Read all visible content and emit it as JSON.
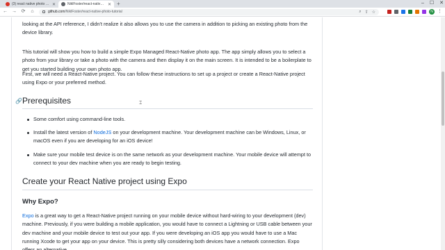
{
  "browser": {
    "tabs": [
      {
        "title": "(3) react native photo tutorial - ...",
        "active": false
      },
      {
        "title": "NiklFoster/react-native-photo-tu...",
        "active": true
      }
    ],
    "new_tab": "+",
    "window_controls": [
      "–",
      "☐",
      "✕"
    ],
    "nav": {
      "back": "←",
      "forward": "→",
      "reload": "⟳",
      "home": "⌂"
    },
    "url_host": "github.com",
    "url_path": "/NiklFoster/react-native-photo-tutorial",
    "omnibox_icons": [
      "search-icon",
      "share-icon",
      "star-icon"
    ],
    "extension_colors": [
      "#c5221f",
      "#5f6368",
      "#1a73e8",
      "#188038",
      "#e37400",
      "#9334e6"
    ],
    "avatar_letter": "N"
  },
  "article": {
    "p1": "looking at the API reference, I didn't realize it also allows you to use the camera in addition to picking an existing photo from the device library.",
    "p2": "This tutorial will show you how to build a simple Expo Managed React-Native photo app. The app simply allows you to select a photo from your library or take a photo with the camera and then display it on the main screen. It is intended to be a boilerplate to get you started building your own photo app.",
    "p3": "First, we will need a React-Native project. You can follow these instructions to set up a project or create a React-Native project using Expo or your preferred method.",
    "prereq_heading": "Prerequisites",
    "prereq_items": {
      "item1": "Some comfort using command-line tools.",
      "item2_before": "Install the latest version of ",
      "item2_link": "NodeJS",
      "item2_after": " on your development machine. Your development machine can be Windows, Linux, or macOS even if you are developing for an iOS device!",
      "item3": "Make sure your mobile test device is on the same network as your development machine. Your mobile device will attempt to connect to your dev machine when you are ready to begin testing."
    },
    "create_heading": "Create your React Native project using Expo",
    "why_heading": "Why Expo?",
    "p4_link": "Expo",
    "p4_text": " is a great way to get a React-Native project running on your mobile device without hard-wiring to your development (dev) machine. Previously, if you were building a mobile application, you would have to connect a Lightning or USB cable between your dev machine and your mobile device to test out your app. If you were developing an iOS app you would have to use a Mac running Xcode to get your app on your device. This is pretty silly considering both devices have a network connection. Expo offers an alternative"
  }
}
